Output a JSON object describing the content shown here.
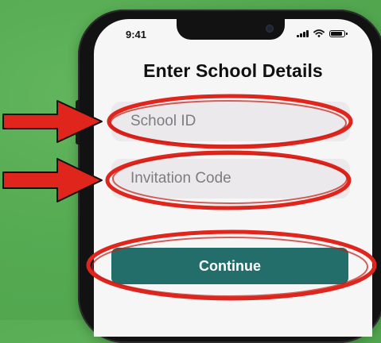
{
  "colors": {
    "background": "#55ab52",
    "annotation": "#e0251c",
    "continue_button": "#236d6a",
    "field_background": "#ebe9ec"
  },
  "status_bar": {
    "time": "9:41",
    "icons": [
      "signal-icon",
      "wifi-icon",
      "battery-icon"
    ]
  },
  "screen": {
    "title": "Enter School Details",
    "school_id": {
      "placeholder": "School ID",
      "value": ""
    },
    "invitation_code": {
      "placeholder": "Invitation Code",
      "value": ""
    },
    "continue_label": "Continue"
  },
  "annotations": {
    "arrows": [
      "arrow-to-school-id",
      "arrow-to-invitation-code"
    ],
    "circled": [
      "school-id",
      "invitation-code",
      "continue"
    ]
  }
}
